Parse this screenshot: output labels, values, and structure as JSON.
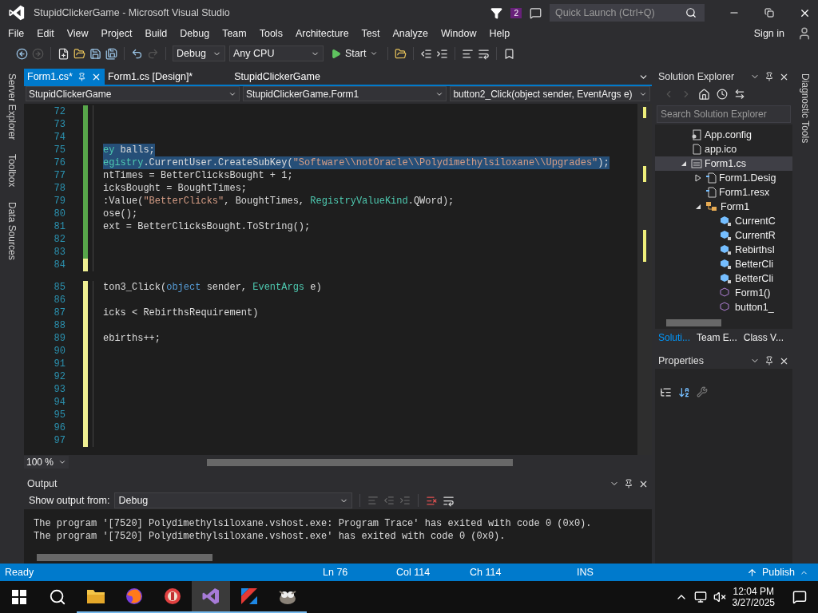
{
  "window": {
    "title": "StupidClickerGame - Microsoft Visual Studio",
    "notification_count": "2",
    "quick_launch": {
      "placeholder": "Quick Launch (Ctrl+Q)"
    }
  },
  "menu": [
    "File",
    "Edit",
    "View",
    "Project",
    "Build",
    "Debug",
    "Team",
    "Tools",
    "Architecture",
    "Test",
    "Analyze",
    "Window",
    "Help"
  ],
  "sign_in": "Sign in",
  "toolbar": {
    "configuration": "Debug",
    "platform": "Any CPU",
    "start": "Start"
  },
  "left_strip": [
    "Server Explorer",
    "Toolbox",
    "Data Sources"
  ],
  "right_strip": [
    "Diagnostic Tools"
  ],
  "document_tabs": [
    {
      "label": "Form1.cs*",
      "selected": true
    },
    {
      "label": "Form1.cs [Design]*",
      "selected": false
    },
    {
      "label": "StupidClickerGame",
      "selected": false
    }
  ],
  "navigation": [
    "StupidClickerGame",
    "StupidClickerGame.Form1",
    "button2_Click(object sender, EventArgs e)"
  ],
  "editor": {
    "lines": [
      {
        "number": "72",
        "saved": true,
        "selected": false
      },
      {
        "number": "73",
        "saved": true,
        "selected": false
      },
      {
        "number": "74",
        "saved": true,
        "selected": false
      },
      {
        "number": "75",
        "saved": true,
        "selected": true,
        "segments": [
          {
            "text": "ey",
            "kind": "type"
          },
          {
            "text": " balls;",
            "kind": "plain"
          }
        ]
      },
      {
        "number": "76",
        "saved": true,
        "selected": true,
        "segments": [
          {
            "text": "egistry",
            "kind": "type"
          },
          {
            "text": ".CurrentUser.CreateSubKey(",
            "kind": "plain"
          },
          {
            "text": "\"Software\\\\notOracle\\\\Polydimethylsiloxane\\\\Upgrades\"",
            "kind": "string"
          },
          {
            "text": ");",
            "kind": "plain"
          }
        ]
      },
      {
        "number": "77",
        "saved": true,
        "selected": false,
        "segments": [
          {
            "text": "ntTimes = BetterClicksBought + 1;",
            "kind": "plain"
          }
        ]
      },
      {
        "number": "78",
        "saved": true,
        "selected": false,
        "segments": [
          {
            "text": "icksBought = BoughtTimes;",
            "kind": "plain"
          }
        ]
      },
      {
        "number": "79",
        "saved": true,
        "selected": false,
        "segments": [
          {
            "text": ":Value(",
            "kind": "plain"
          },
          {
            "text": "\"BetterClicks\"",
            "kind": "string"
          },
          {
            "text": ", BoughtTimes, ",
            "kind": "plain"
          },
          {
            "text": "RegistryValueKind",
            "kind": "type"
          },
          {
            "text": ".QWord);",
            "kind": "plain"
          }
        ]
      },
      {
        "number": "80",
        "saved": true,
        "selected": false,
        "segments": [
          {
            "text": "ose();",
            "kind": "plain"
          }
        ]
      },
      {
        "number": "81",
        "saved": true,
        "selected": false,
        "segments": [
          {
            "text": "ext = BetterClicksBought.ToString();",
            "kind": "plain"
          }
        ]
      },
      {
        "number": "82",
        "saved": true,
        "selected": false
      },
      {
        "number": "83",
        "saved": true,
        "selected": false
      },
      {
        "number": "84",
        "saved": false,
        "selected": false
      },
      {
        "number": "85",
        "saved": false,
        "selected": false,
        "segments": [
          {
            "text": "ton3_Click(",
            "kind": "plain"
          },
          {
            "text": "object",
            "kind": "keyword"
          },
          {
            "text": " sender, ",
            "kind": "plain"
          },
          {
            "text": "EventArgs",
            "kind": "type"
          },
          {
            "text": " e)",
            "kind": "plain"
          }
        ]
      },
      {
        "number": "86",
        "saved": false,
        "selected": false
      },
      {
        "number": "87",
        "saved": false,
        "selected": false,
        "segments": [
          {
            "text": "icks < RebirthsRequirement)",
            "kind": "plain"
          }
        ]
      },
      {
        "number": "88",
        "saved": false,
        "selected": false
      },
      {
        "number": "89",
        "saved": false,
        "selected": false,
        "segments": [
          {
            "text": "ebirths++;",
            "kind": "plain"
          }
        ]
      },
      {
        "number": "90",
        "saved": false,
        "selected": false
      },
      {
        "number": "91",
        "saved": false,
        "selected": false
      },
      {
        "number": "92",
        "saved": false,
        "selected": false
      },
      {
        "number": "93",
        "saved": false,
        "selected": false
      },
      {
        "number": "94",
        "saved": false,
        "selected": false
      },
      {
        "number": "95",
        "saved": false,
        "selected": false
      },
      {
        "number": "96",
        "saved": false,
        "selected": false
      },
      {
        "number": "97",
        "saved": false,
        "selected": false
      }
    ],
    "zoom": "100 %"
  },
  "output": {
    "title": "Output",
    "show_from_label": "Show output from:",
    "source": "Debug",
    "lines": [
      "The program '[7520] Polydimethylsiloxane.vshost.exe: Program Trace' has exited with code 0 (0x0).",
      "The program '[7520] Polydimethylsiloxane.vshost.exe' has exited with code 0 (0x0)."
    ]
  },
  "solution_explorer": {
    "title": "Solution Explorer",
    "search": {
      "placeholder": "Search Solution Explorer"
    },
    "tree": [
      {
        "label": "App.config",
        "kind": "config",
        "selected": false
      },
      {
        "label": "app.ico",
        "kind": "file",
        "selected": false
      },
      {
        "label": "Form1.cs",
        "kind": "form",
        "selected": true,
        "expanded": true,
        "children": [
          {
            "label": "Form1.Desig",
            "kind": "code",
            "selected": false,
            "expanded": false
          },
          {
            "label": "Form1.resx",
            "kind": "code",
            "selected": false
          },
          {
            "label": "Form1",
            "kind": "class",
            "selected": false,
            "expanded": true,
            "children": [
              {
                "label": "CurrentC",
                "kind": "field",
                "selected": false
              },
              {
                "label": "CurrentR",
                "kind": "field",
                "selected": false
              },
              {
                "label": "RebirthsI",
                "kind": "field",
                "selected": false
              },
              {
                "label": "BetterCli",
                "kind": "field",
                "selected": false
              },
              {
                "label": "BetterCli",
                "kind": "field",
                "selected": false
              },
              {
                "label": "Form1()",
                "kind": "method",
                "selected": false
              },
              {
                "label": "button1_",
                "kind": "method",
                "selected": false
              }
            ]
          }
        ]
      }
    ],
    "tabs": [
      {
        "label": "Soluti...",
        "selected": true
      },
      {
        "label": "Team E...",
        "selected": false
      },
      {
        "label": "Class V...",
        "selected": false
      }
    ]
  },
  "properties": {
    "title": "Properties"
  },
  "status_bar": {
    "state": "Ready",
    "line": "Ln 76",
    "column": "Col 114",
    "character": "Ch 114",
    "mode": "INS",
    "publish": "Publish"
  },
  "taskbar": {
    "apps": [
      {
        "kind": "folder",
        "selected": false
      },
      {
        "kind": "fox",
        "selected": false
      },
      {
        "kind": "ball",
        "selected": false
      },
      {
        "kind": "studio",
        "selected": true
      },
      {
        "kind": "kite",
        "selected": false
      },
      {
        "kind": "critter",
        "selected": false
      }
    ],
    "time": "12:04 PM",
    "date": "3/27/2025"
  }
}
